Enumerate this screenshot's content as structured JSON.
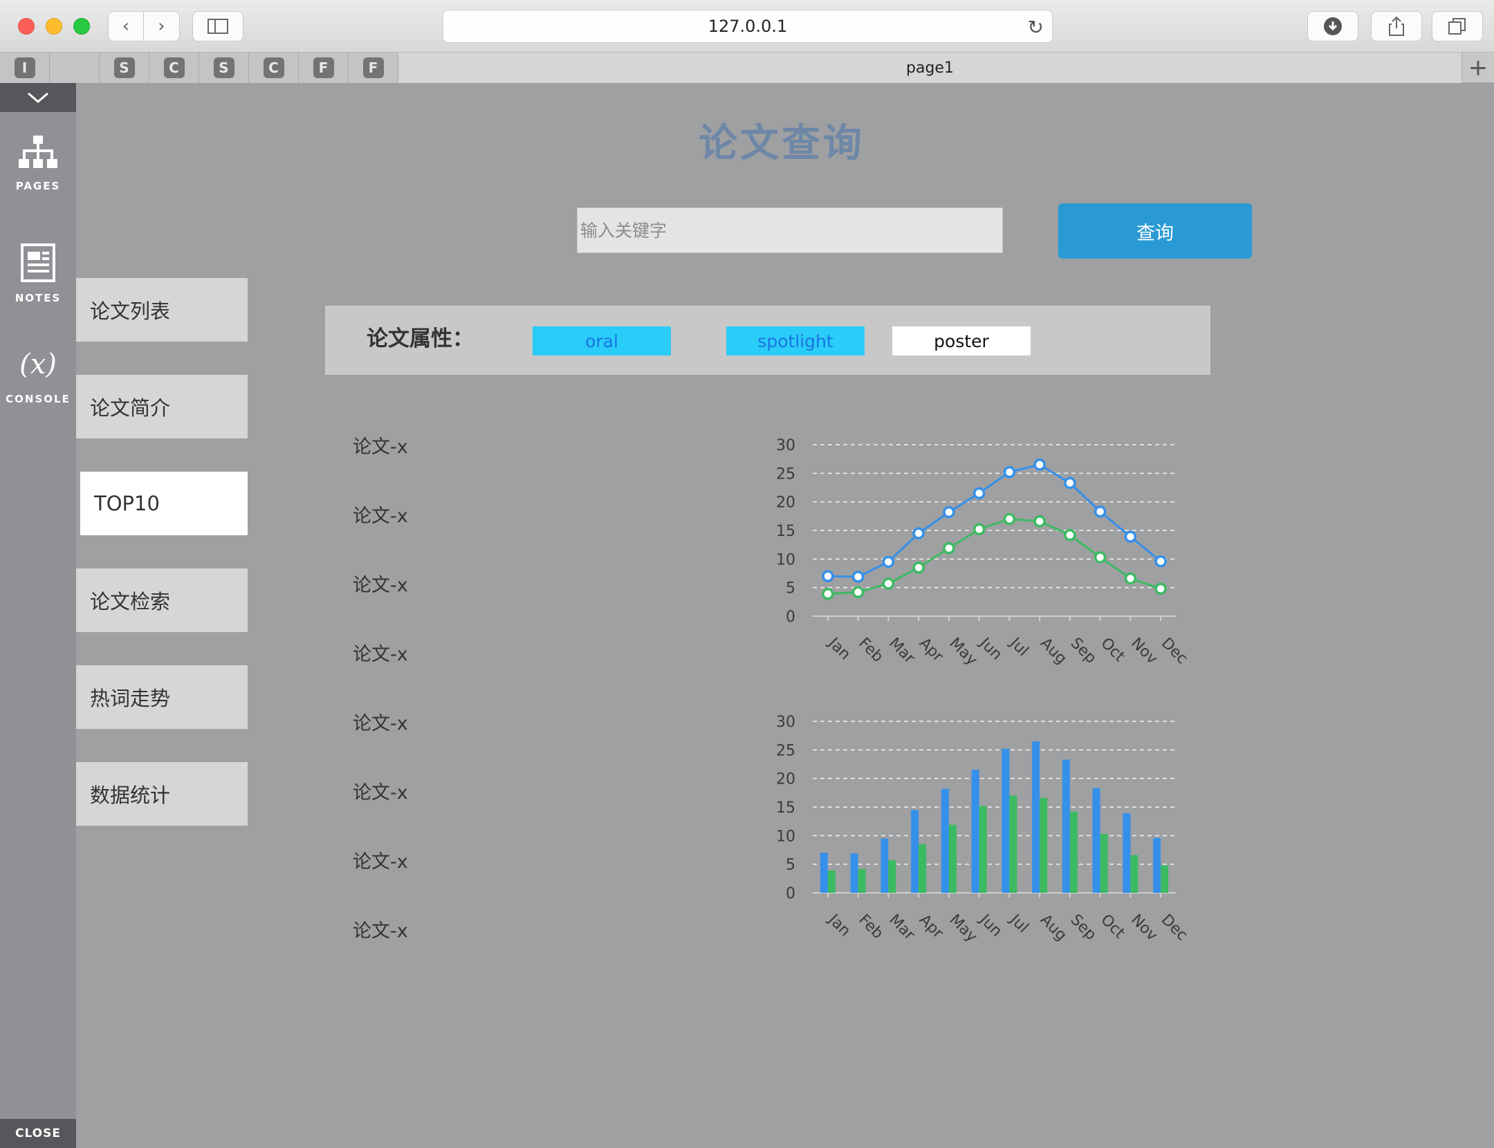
{
  "browser": {
    "url": "127.0.0.1",
    "tab_title": "page1",
    "pinned_tabs": [
      "I",
      "",
      "S",
      "C",
      "S",
      "C",
      "F",
      "F"
    ]
  },
  "tools": {
    "pages_label": "PAGES",
    "notes_label": "NOTES",
    "console_symbol": "(x)",
    "console_label": "CONSOLE",
    "close_label": "CLOSE"
  },
  "nav": {
    "items": [
      {
        "label": "论文列表",
        "active": false
      },
      {
        "label": "论文简介",
        "active": false
      },
      {
        "label": "TOP10",
        "active": true
      },
      {
        "label": "论文检索",
        "active": false
      },
      {
        "label": "热词走势",
        "active": false
      },
      {
        "label": "数据统计",
        "active": false
      }
    ]
  },
  "main": {
    "title": "论文查询",
    "search": {
      "placeholder": "输入关键字",
      "value": "",
      "button_label": "查询"
    },
    "attributes": {
      "label": "论文属性：",
      "options": [
        {
          "label": "oral",
          "selected": true
        },
        {
          "label": "spotlight",
          "selected": true
        },
        {
          "label": "poster",
          "selected": false
        }
      ]
    },
    "paper_list": [
      "论文-x",
      "论文-x",
      "论文-x",
      "论文-x",
      "论文-x",
      "论文-x",
      "论文-x",
      "论文-x"
    ]
  },
  "colors": {
    "series_blue": "#3590ea",
    "series_green": "#3cba62",
    "accent": "#2a9ad4",
    "title": "#6e87a6"
  },
  "chart_data": [
    {
      "type": "line",
      "categories": [
        "Jan",
        "Feb",
        "Mar",
        "Apr",
        "May",
        "Jun",
        "Jul",
        "Aug",
        "Sep",
        "Oct",
        "Nov",
        "Dec"
      ],
      "series": [
        {
          "color": "#3590ea",
          "values": [
            7.0,
            6.9,
            9.5,
            14.5,
            18.2,
            21.5,
            25.2,
            26.5,
            23.3,
            18.3,
            13.9,
            9.6
          ]
        },
        {
          "color": "#3cba62",
          "values": [
            3.9,
            4.2,
            5.7,
            8.5,
            11.9,
            15.2,
            17.0,
            16.6,
            14.2,
            10.3,
            6.6,
            4.8
          ]
        }
      ],
      "ylim": [
        0,
        30
      ],
      "yticks": [
        0,
        5,
        10,
        15,
        20,
        25,
        30
      ],
      "grid": true
    },
    {
      "type": "bar",
      "categories": [
        "Jan",
        "Feb",
        "Mar",
        "Apr",
        "May",
        "Jun",
        "Jul",
        "Aug",
        "Sep",
        "Oct",
        "Nov",
        "Dec"
      ],
      "series": [
        {
          "color": "#3590ea",
          "values": [
            7.0,
            6.9,
            9.5,
            14.5,
            18.2,
            21.5,
            25.2,
            26.5,
            23.3,
            18.3,
            13.9,
            9.6
          ]
        },
        {
          "color": "#3cba62",
          "values": [
            3.9,
            4.2,
            5.7,
            8.5,
            11.9,
            15.2,
            17.0,
            16.6,
            14.2,
            10.3,
            6.6,
            4.8
          ]
        }
      ],
      "ylim": [
        0,
        30
      ],
      "yticks": [
        0,
        5,
        10,
        15,
        20,
        25,
        30
      ],
      "grid": true
    }
  ]
}
